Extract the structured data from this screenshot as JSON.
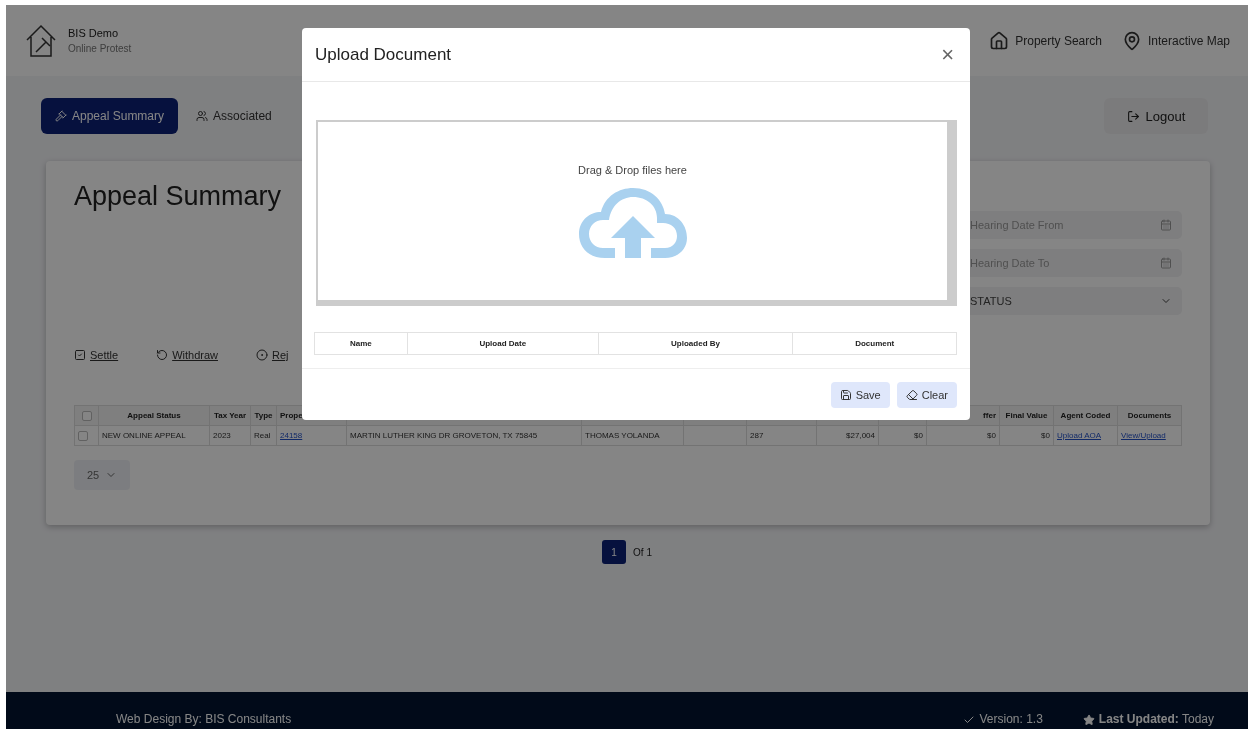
{
  "header": {
    "brand": {
      "title": "BIS Demo",
      "subtitle": "Online Protest"
    },
    "links": [
      {
        "kind": "search",
        "label": "Property Search"
      },
      {
        "kind": "map",
        "label": "Interactive Map"
      }
    ]
  },
  "nav": {
    "tabs": [
      {
        "label": "Appeal Summary",
        "kind": "gavel",
        "selected": true
      },
      {
        "label": "Associated",
        "kind": "users",
        "selected": false
      }
    ],
    "logout": "Logout"
  },
  "summary": {
    "title": "Appeal Summary",
    "filters": [
      {
        "kind": "date",
        "placeholder": "Hearing Date From"
      },
      {
        "kind": "date",
        "placeholder": "Hearing Date To"
      },
      {
        "kind": "select",
        "value": "STATUS"
      }
    ],
    "actions": [
      {
        "kind": "check",
        "label": "Settle"
      },
      {
        "kind": "undo",
        "label": "Withdraw"
      },
      {
        "kind": "circle",
        "label": "Rej"
      }
    ],
    "table": {
      "columns": [
        "Appeal Status",
        "Tax Year",
        "Type",
        "Prope",
        "",
        "",
        "",
        "",
        "",
        "",
        "ffer",
        "Final Value",
        "Agent Coded",
        "Documents"
      ],
      "select_all_checked": false,
      "rows": [
        {
          "checked": false,
          "cells": [
            {
              "kind": "text",
              "text": "NEW ONLINE APPEAL"
            },
            {
              "kind": "text",
              "text": "2023"
            },
            {
              "kind": "text",
              "text": "Real"
            },
            {
              "kind": "link",
              "text": "24158"
            },
            {
              "kind": "text",
              "text": "MARTIN LUTHER KING DR GROVETON, TX 75845"
            },
            {
              "kind": "text",
              "text": "THOMAS YOLANDA"
            },
            {
              "kind": "text",
              "text": ""
            },
            {
              "kind": "text",
              "text": "287"
            },
            {
              "kind": "money",
              "text": "$27,004"
            },
            {
              "kind": "money",
              "text": "$0"
            },
            {
              "kind": "money",
              "text": "$0"
            },
            {
              "kind": "money",
              "text": "$0"
            },
            {
              "kind": "link",
              "text": "Upload AOA"
            },
            {
              "kind": "link",
              "text": "View/Upload"
            }
          ]
        }
      ]
    },
    "page_size": "25"
  },
  "pagination": {
    "pages": [
      {
        "label": "1",
        "selected": true
      }
    ],
    "total": "Of 1"
  },
  "footer": {
    "credit": "Web Design By: BIS Consultants",
    "version": "Version: 1.3",
    "updated": "**Last Updated:** Today"
  },
  "modal": {
    "title": "Upload Document",
    "close": "×",
    "dropzone": "Drag & Drop files here",
    "columns": [
      "Name",
      "Upload Date",
      "Uploaded By",
      "Document"
    ],
    "buttons": [
      {
        "kind": "save",
        "label": "Save"
      },
      {
        "kind": "clear",
        "label": "Clear"
      }
    ]
  }
}
